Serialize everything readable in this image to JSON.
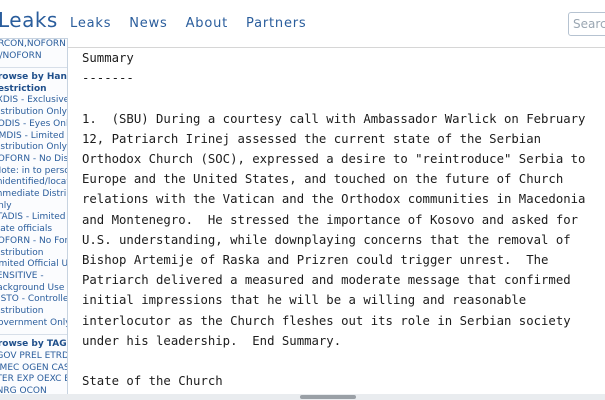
{
  "header": {
    "brand": "Leaks",
    "nav": [
      "Leaks",
      "News",
      "About",
      "Partners"
    ],
    "search_placeholder": "Search"
  },
  "sidebar": {
    "top_lines": [
      "ORCON,NOFORN",
      "T//NOFORN"
    ],
    "handling_heading": [
      "Browse by Handling",
      "Restriction"
    ],
    "handling_items": [
      "EXDIS - Exclusive",
      "Distribution Only",
      "NODIS - Eyes Only",
      "LIMDIS - Limited",
      "Distribution Only",
      "NOFORN - No Distribution",
      "(Note: in to persons",
      "unidentified/located)",
      "Immediate Distribution",
      "Only",
      "STADIS - Limited to",
      "State officials",
      "NOFORN - No Foreign",
      "Distribution",
      "Limited Official Use",
      "SENSITIVE -",
      "Background Use Only",
      "DISTO - Controlled",
      "Distribution",
      "Government Only"
    ],
    "tags_heading": "Browse by TAGS",
    "tags_lines": [
      "PGOV PREL ETRD",
      "KIMEC OGEN CASC",
      "PTER EXP OEXC EAID",
      "ENRG OCON"
    ]
  },
  "main": {
    "summary_heading": "Summary",
    "summary_rule": "-------",
    "paragraph_lines": [
      "1.  (SBU) During a courtesy call with Ambassador Warlick on February",
      "12, Patriarch Irinej assessed the current state of the Serbian",
      "Orthodox Church (SOC), expressed a desire to \"reintroduce\" Serbia to",
      "Europe and the United States, and touched on the future of Church",
      "relations with the Vatican and the Orthodox communities in Macedonia",
      "and Montenegro.  He stressed the importance of Kosovo and asked for",
      "U.S. understanding, while downplaying concerns that the removal of",
      "Bishop Artemije of Raska and Prizren could trigger unrest.  The",
      "Patriarch delivered a measured and moderate message that confirmed",
      "initial impressions that he will be a willing and reasonable",
      "interlocutor as the Church fleshes out its role in Serbian society",
      "under his leadership.  End Summary."
    ],
    "section_heading": "State of the Church"
  }
}
